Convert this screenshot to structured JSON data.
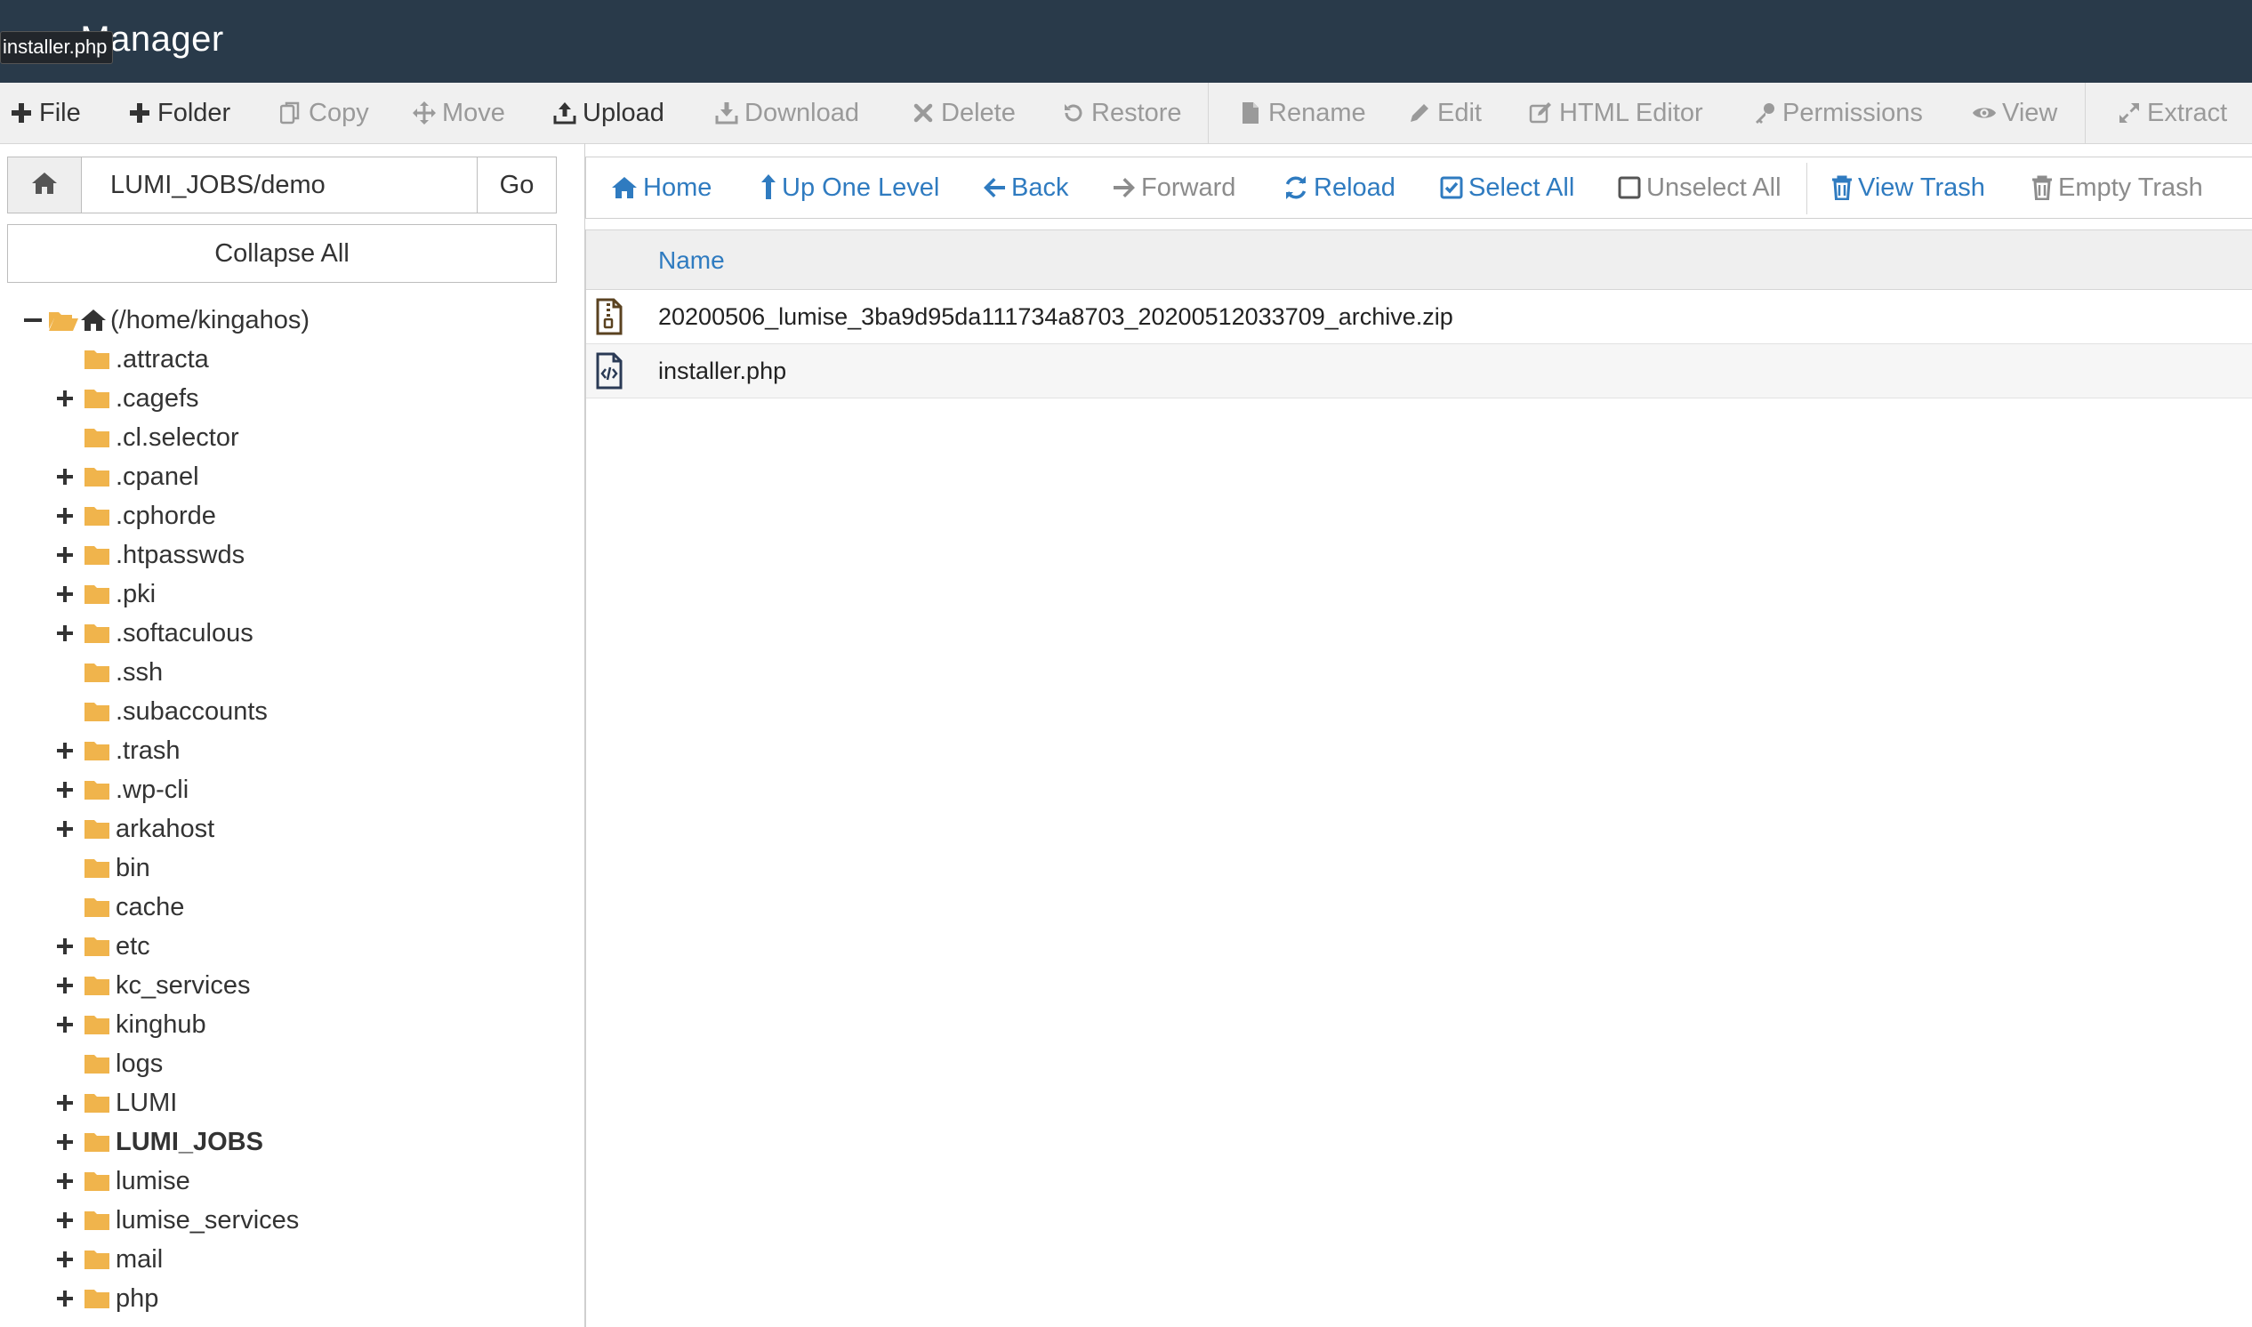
{
  "header": {
    "title": "e Manager",
    "tooltip": "installer.php"
  },
  "toolbar": [
    {
      "label": "File",
      "icon": "plus-icon",
      "enabled": true
    },
    {
      "label": "Folder",
      "icon": "plus-icon",
      "enabled": true
    },
    {
      "label": "Copy",
      "icon": "copy-icon",
      "enabled": false
    },
    {
      "label": "Move",
      "icon": "move-icon",
      "enabled": false
    },
    {
      "label": "Upload",
      "icon": "upload-icon",
      "enabled": true
    },
    {
      "label": "Download",
      "icon": "download-icon",
      "enabled": false
    },
    {
      "label": "Delete",
      "icon": "delete-icon",
      "enabled": false
    },
    {
      "label": "Restore",
      "icon": "restore-icon",
      "enabled": false
    },
    {
      "label": "Rename",
      "icon": "file-icon",
      "enabled": false
    },
    {
      "label": "Edit",
      "icon": "pencil-icon",
      "enabled": false
    },
    {
      "label": "HTML Editor",
      "icon": "edit-icon",
      "enabled": false
    },
    {
      "label": "Permissions",
      "icon": "key-icon",
      "enabled": false
    },
    {
      "label": "View",
      "icon": "eye-icon",
      "enabled": false
    },
    {
      "label": "Extract",
      "icon": "expand-icon",
      "enabled": false
    }
  ],
  "path": {
    "value": "LUMI_JOBS/demo",
    "go_label": "Go"
  },
  "collapse_label": "Collapse All",
  "tree": {
    "root_label": "(/home/kingahos)",
    "items": [
      {
        "label": ".attracta",
        "expandable": false
      },
      {
        "label": ".cagefs",
        "expandable": true
      },
      {
        "label": ".cl.selector",
        "expandable": false
      },
      {
        "label": ".cpanel",
        "expandable": true
      },
      {
        "label": ".cphorde",
        "expandable": true
      },
      {
        "label": ".htpasswds",
        "expandable": true
      },
      {
        "label": ".pki",
        "expandable": true
      },
      {
        "label": ".softaculous",
        "expandable": true
      },
      {
        "label": ".ssh",
        "expandable": false
      },
      {
        "label": ".subaccounts",
        "expandable": false
      },
      {
        "label": ".trash",
        "expandable": true
      },
      {
        "label": ".wp-cli",
        "expandable": true
      },
      {
        "label": "arkahost",
        "expandable": true
      },
      {
        "label": "bin",
        "expandable": false
      },
      {
        "label": "cache",
        "expandable": false
      },
      {
        "label": "etc",
        "expandable": true
      },
      {
        "label": "kc_services",
        "expandable": true
      },
      {
        "label": "kinghub",
        "expandable": true
      },
      {
        "label": "logs",
        "expandable": false
      },
      {
        "label": "LUMI",
        "expandable": true
      },
      {
        "label": "LUMI_JOBS",
        "expandable": true,
        "current": true
      },
      {
        "label": "lumise",
        "expandable": true
      },
      {
        "label": "lumise_services",
        "expandable": true
      },
      {
        "label": "mail",
        "expandable": true
      },
      {
        "label": "php",
        "expandable": true
      }
    ]
  },
  "nav": [
    {
      "label": "Home",
      "icon": "home-icon",
      "enabled": true
    },
    {
      "label": "Up One Level",
      "icon": "level-up-icon",
      "enabled": true
    },
    {
      "label": "Back",
      "icon": "arrow-left-icon",
      "enabled": true
    },
    {
      "label": "Forward",
      "icon": "arrow-right-icon",
      "enabled": false
    },
    {
      "label": "Reload",
      "icon": "refresh-icon",
      "enabled": true
    },
    {
      "label": "Select All",
      "icon": "checkbox-checked-icon",
      "enabled": true
    },
    {
      "label": "Unselect All",
      "icon": "checkbox-empty-icon",
      "enabled": false
    },
    {
      "label": "View Trash",
      "icon": "trash-icon",
      "enabled": true
    },
    {
      "label": "Empty Trash",
      "icon": "trash-icon",
      "enabled": false
    }
  ],
  "table": {
    "name_header": "Name",
    "files": [
      {
        "name": "20200506_lumise_3ba9d95da111734a8703_20200512033709_archive.zip",
        "icon": "zip-file-icon"
      },
      {
        "name": "installer.php",
        "icon": "code-file-icon"
      }
    ]
  },
  "colors": {
    "header_bg": "#293a4a",
    "link": "#2f7bc0",
    "folder": "#f0b44c"
  }
}
